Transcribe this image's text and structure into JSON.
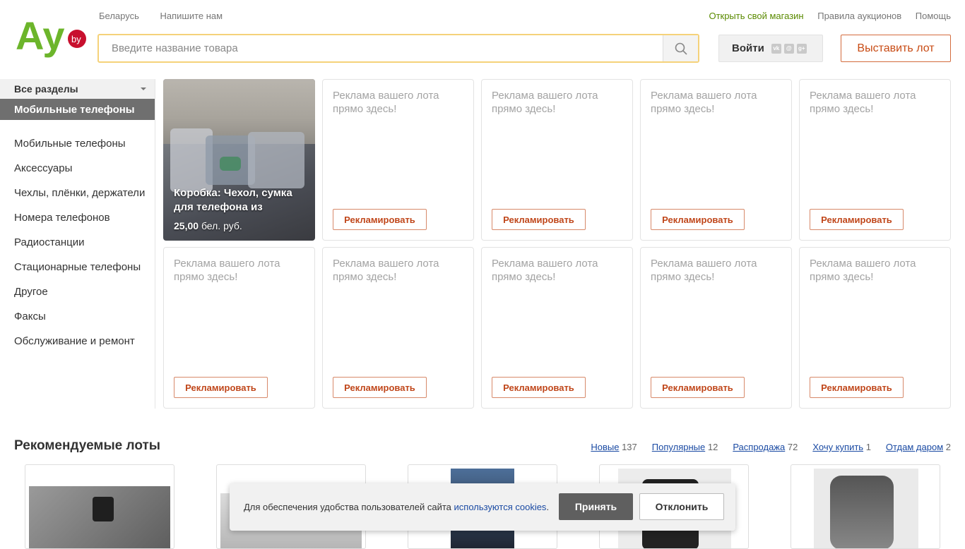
{
  "header": {
    "logo_text": "Ay",
    "logo_badge": "by",
    "top_left_links": [
      "Беларусь",
      "Напишите нам"
    ],
    "top_right_links": [
      "Открыть свой магазин",
      "Правила аукционов",
      "Помощь"
    ],
    "search_placeholder": "Введите название товара",
    "login_label": "Войти",
    "social_icons": [
      "vk-icon",
      "mailru-icon",
      "google-plus-icon"
    ],
    "sell_button": "Выставить лот"
  },
  "sidebar": {
    "all_sections": "Все разделы",
    "active": "Мобильные телефоны",
    "items": [
      "Мобильные телефоны",
      "Аксессуары",
      "Чехлы, плёнки, держатели",
      "Номера телефонов",
      "Радиостанции",
      "Стационарные телефоны",
      "Другое",
      "Факсы",
      "Обслуживание и ремонт"
    ]
  },
  "featured": {
    "title": "Коробка: Чехол, сумка для телефона из",
    "price": "25,00",
    "currency": "бел. руб."
  },
  "ad_card": {
    "text": "Реклама вашего лота прямо здесь!",
    "button": "Рекламировать"
  },
  "recommended": {
    "title": "Рекомендуемые лоты",
    "filters": [
      {
        "label": "Новые",
        "count": "137"
      },
      {
        "label": "Популярные",
        "count": "12"
      },
      {
        "label": "Распродажа",
        "count": "72"
      },
      {
        "label": "Хочу купить",
        "count": "1"
      },
      {
        "label": "Отдам даром",
        "count": "2"
      }
    ]
  },
  "cookie": {
    "text": "Для обеспечения удобства пользователей сайта",
    "link": "используются cookies",
    "accept": "Принять",
    "decline": "Отклонить"
  },
  "colors": {
    "brand_green": "#6cb52b",
    "brand_red": "#c8102e",
    "accent_orange": "#c84b14"
  }
}
